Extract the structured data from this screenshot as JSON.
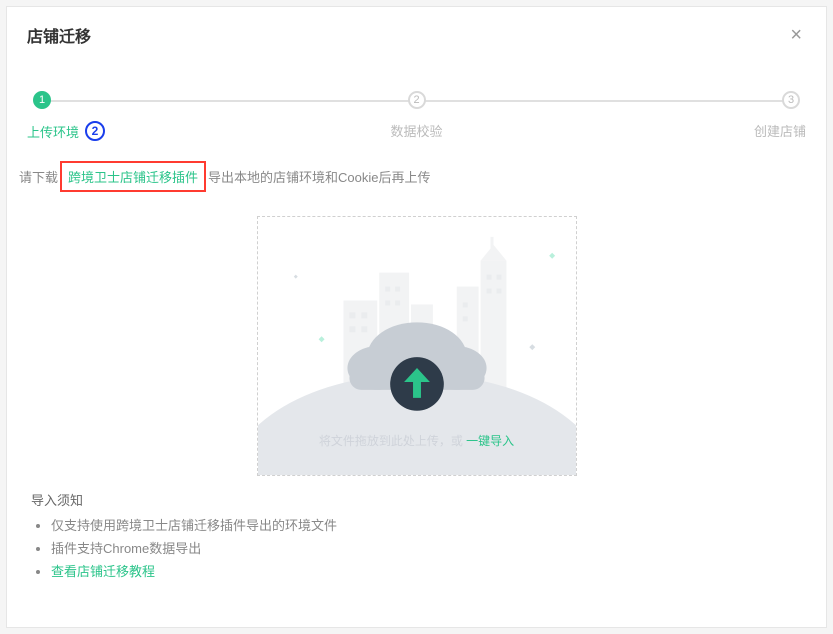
{
  "modal": {
    "title": "店铺迁移",
    "close_glyph": "×"
  },
  "steps": {
    "items": [
      {
        "num": "1",
        "label": "上传环境",
        "active": true
      },
      {
        "num": "2",
        "label": "数据校验",
        "active": false
      },
      {
        "num": "3",
        "label": "创建店铺",
        "active": false
      }
    ],
    "annotation_badge": "2"
  },
  "instruction": {
    "prefix": "请下载",
    "link_text": "跨境卫士店铺迁移插件",
    "suffix": "导出本地的店铺环境和Cookie后再上传"
  },
  "upload": {
    "drag_text": "将文件拖放到此处上传，或 ",
    "action_text": "一键导入"
  },
  "notice": {
    "title": "导入须知",
    "items": {
      "i0": "仅支持使用跨境卫士店铺迁移插件导出的环境文件",
      "i1": "插件支持Chrome数据导出",
      "i2_link": "查看店铺迁移教程"
    }
  }
}
